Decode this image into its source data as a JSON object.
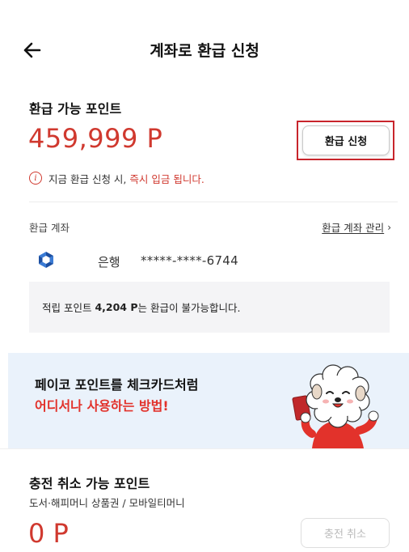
{
  "header": {
    "title": "계좌로 환급 신청"
  },
  "refundable": {
    "label": "환급 가능 포인트",
    "value": "459,999 P",
    "button_label": "환급 신청",
    "notice_prefix": "지금 환급 신청 시,",
    "notice_emphasis": "즉시 입금 됩니다."
  },
  "account": {
    "label": "환급 계좌",
    "manage_label": "환급 계좌 관리",
    "manage_chevron": "›",
    "bank_name": "은행",
    "account_number": "*****-****-6744"
  },
  "info": {
    "text_prefix": "적립 포인트",
    "amount": "4,204 P",
    "text_suffix": "는 환급이 불가능합니다."
  },
  "banner": {
    "title": "페이코 포인트를 체크카드처럼",
    "subtitle": "어디서나 사용하는 방법!"
  },
  "charge_cancel": {
    "label": "충전 취소 가능 포인트",
    "sublabel": "도서·해피머니 상품권 / 모바일티머니",
    "value": "0 P",
    "button_label": "충전 취소"
  },
  "icons": {
    "back": "arrow-left-icon",
    "info": "info-icon",
    "bank_logo": "bank-logo-icon",
    "chevron": "chevron-right-icon",
    "mascot": "dog-mascot-illustration"
  },
  "colors": {
    "accent_red": "#d0392f",
    "highlight_border": "#c8252c",
    "banner_bg": "#eaf2fb",
    "info_box_bg": "#f4f4f6"
  }
}
